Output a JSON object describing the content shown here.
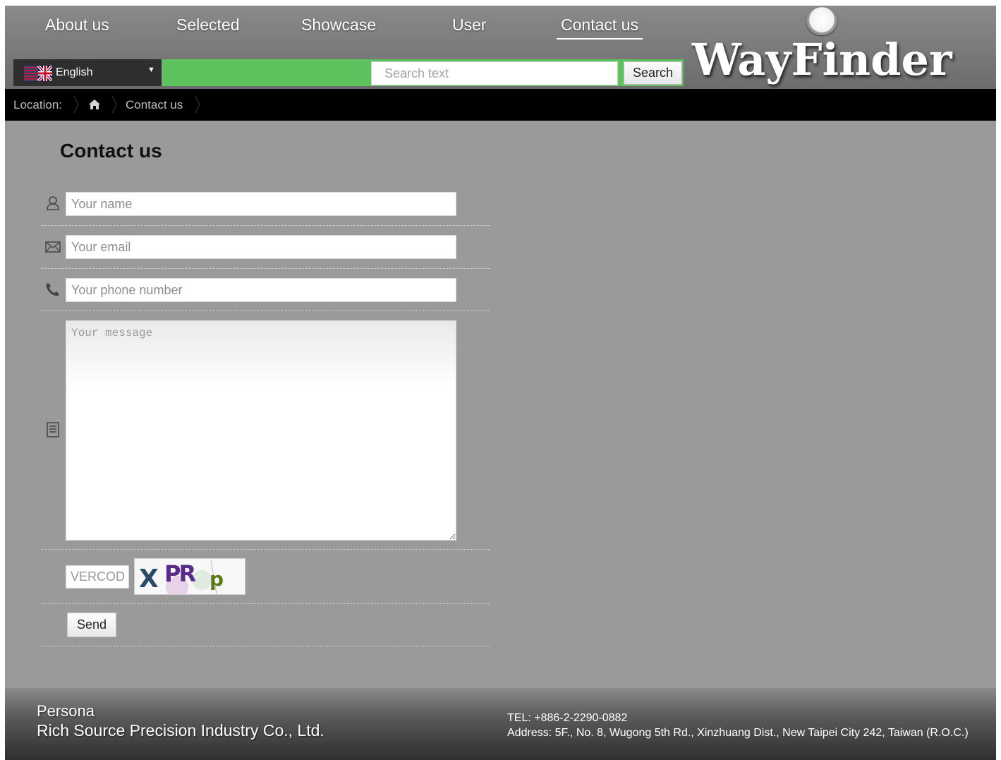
{
  "nav": {
    "items": [
      {
        "label": "About us"
      },
      {
        "label": "Selected"
      },
      {
        "label": "Showcase"
      },
      {
        "label": "User"
      },
      {
        "label": "Contact us",
        "active": true
      }
    ]
  },
  "language": {
    "selected": "English",
    "flag": "uk-flag-icon"
  },
  "search": {
    "placeholder": "Search text",
    "button_label": "Search"
  },
  "logo": {
    "text": "WayFinder"
  },
  "breadcrumb": {
    "prefix": "Location:",
    "home_icon": "home-icon",
    "current": "Contact us"
  },
  "page": {
    "title": "Contact us"
  },
  "form": {
    "name_placeholder": "Your name",
    "email_placeholder": "Your email",
    "phone_placeholder": "Your phone number",
    "message_placeholder": "Your message",
    "vercode_placeholder": "VERCOD",
    "captcha_text": "XPRp",
    "send_label": "Send",
    "icons": [
      "user-icon",
      "envelope-icon",
      "phone-icon",
      "note-icon"
    ]
  },
  "footer": {
    "line1": "Persona",
    "line2": "Rich Source Precision Industry Co., Ltd.",
    "tel": "TEL: +886-2-2290-0882",
    "address": "Address: 5F., No. 8, Wugong 5th Rd., Xinzhuang Dist., New Taipei City 242, Taiwan (R.O.C.)"
  },
  "colors": {
    "accent_green": "#5dc15d",
    "page_gray": "#9a9a9a",
    "breadcrumb_bg": "#000000"
  }
}
